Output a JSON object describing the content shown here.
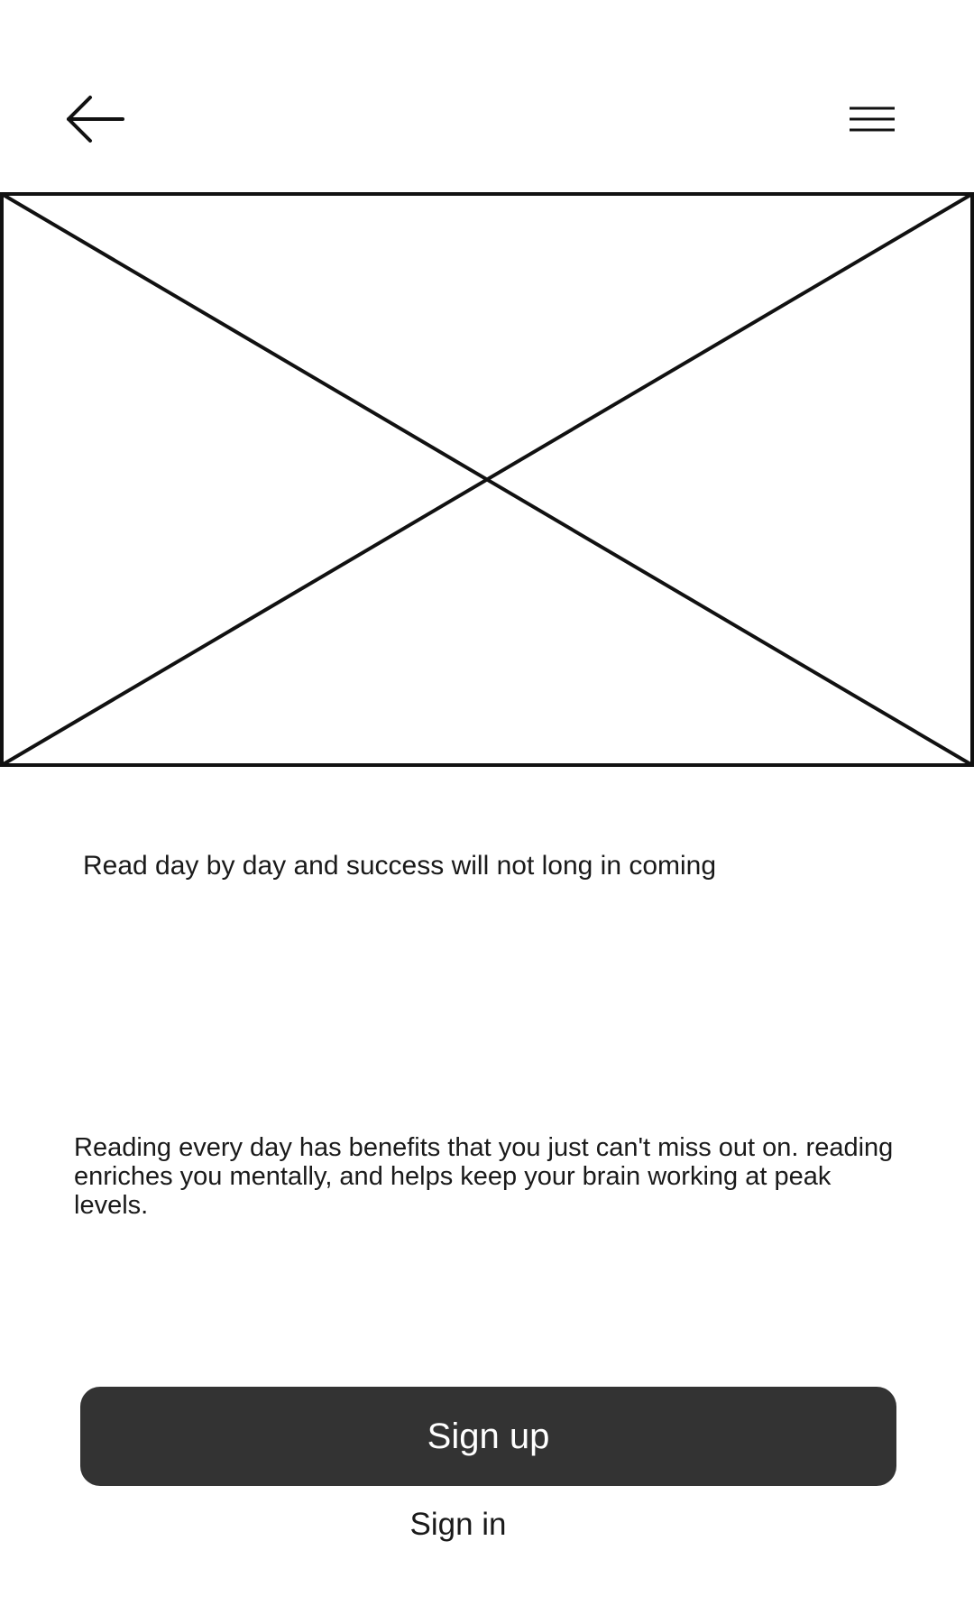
{
  "header": {
    "back_icon": "arrow-left-icon",
    "menu_icon": "hamburger-menu-icon"
  },
  "hero": {
    "type": "image-placeholder"
  },
  "content": {
    "tagline": "Read day by day and success will not long in coming",
    "description": "Reading every day has benefits that you just can't miss out on. reading enriches you mentally, and helps keep your brain working at peak levels."
  },
  "actions": {
    "signup_label": "Sign up",
    "signin_label": "Sign in"
  },
  "colors": {
    "button_bg": "#333333",
    "button_text": "#ffffff",
    "text": "#1a1a1a",
    "background": "#ffffff"
  }
}
